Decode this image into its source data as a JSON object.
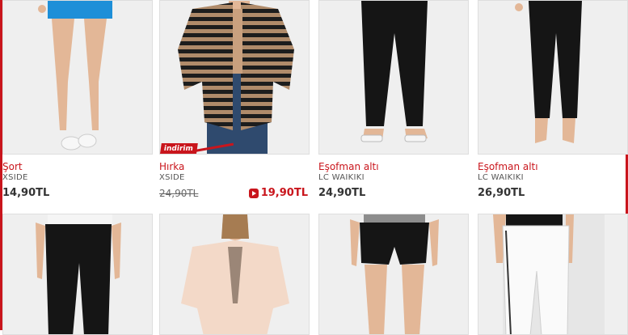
{
  "products": [
    {
      "title": "Şort",
      "brand": "XSIDE",
      "price": "14,90TL"
    },
    {
      "title": "Hırka",
      "brand": "XSIDE",
      "old_price": "24,90TL",
      "price": "19,90TL",
      "badge": "indirim"
    },
    {
      "title": "Eşofman altı",
      "brand": "LC WAIKIKI",
      "price": "24,90TL"
    },
    {
      "title": "Eşofman altı",
      "brand": "LC WAIKIKI",
      "price": "26,90TL"
    }
  ],
  "colors": {
    "accent": "#c9151c",
    "border": "#dedede",
    "image_bg": "#efefef"
  }
}
